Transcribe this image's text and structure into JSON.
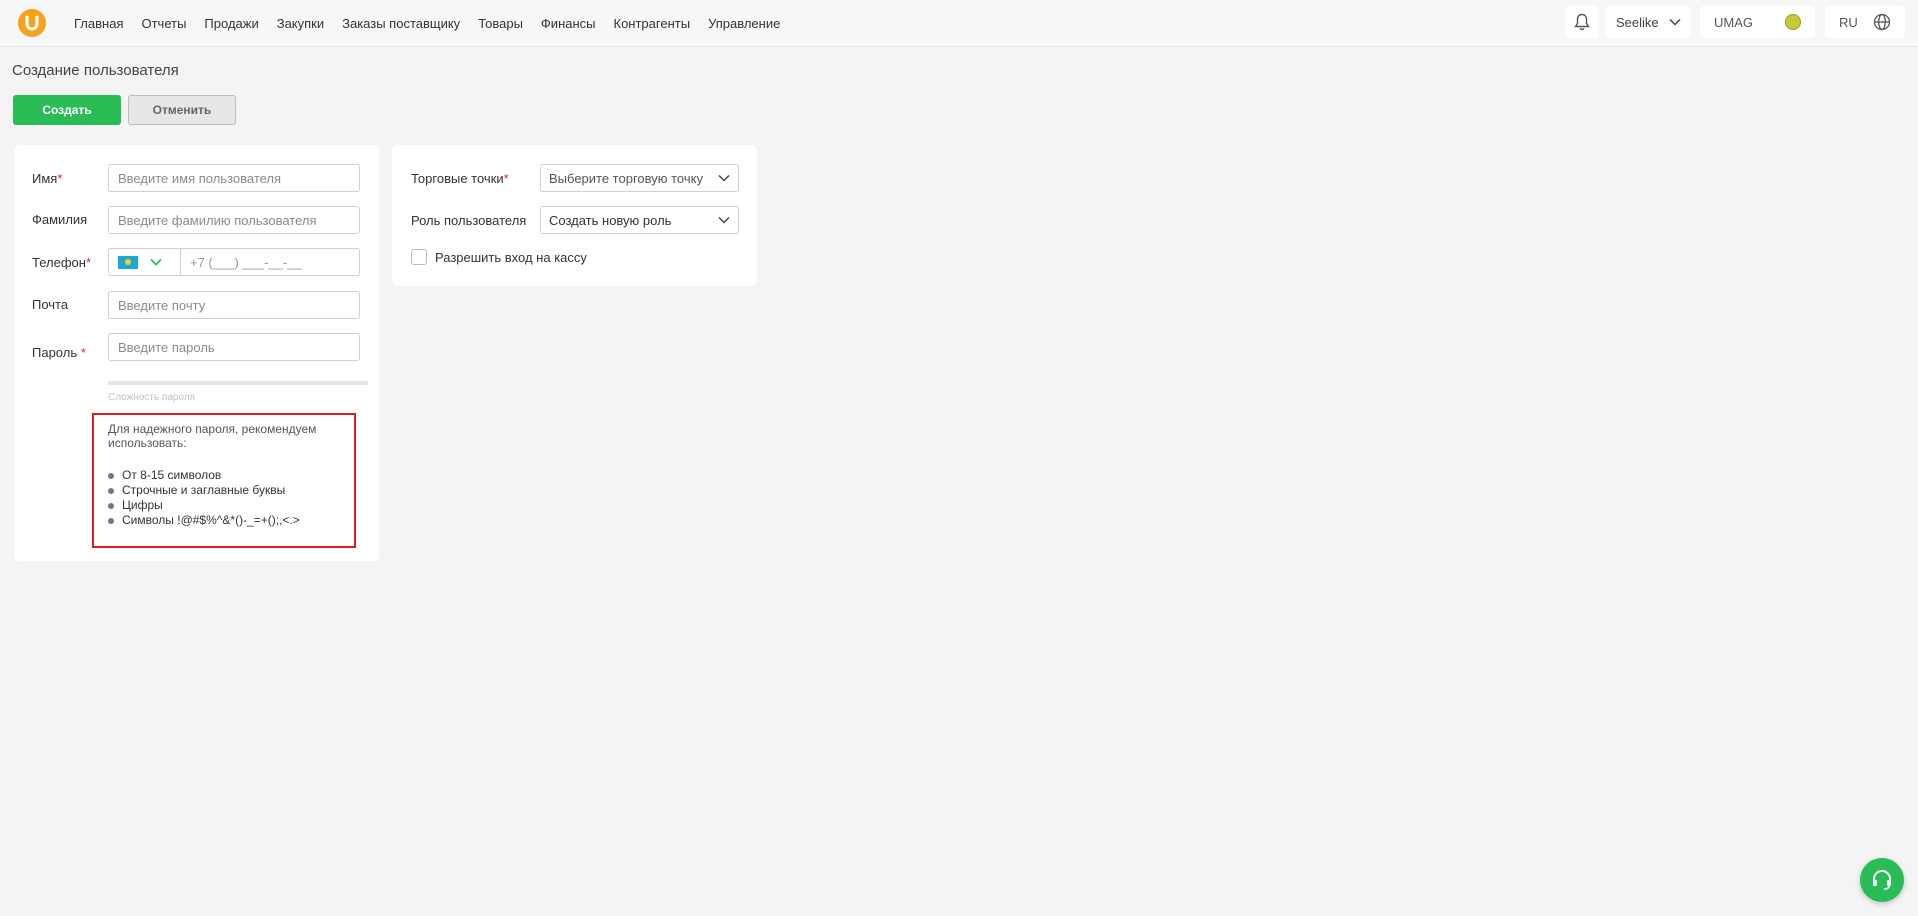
{
  "nav": {
    "items": [
      "Главная",
      "Отчеты",
      "Продажи",
      "Закупки",
      "Заказы поставщику",
      "Товары",
      "Финансы",
      "Контрагенты",
      "Управление"
    ]
  },
  "header": {
    "store": "Seelike",
    "user": "UMAG",
    "language": "RU"
  },
  "page": {
    "title": "Создание пользователя",
    "create_label": "Создать",
    "cancel_label": "Отменить"
  },
  "form": {
    "first_name": {
      "label": "Имя",
      "required": "*",
      "placeholder": "Введите имя пользователя"
    },
    "last_name": {
      "label": "Фамилия",
      "placeholder": "Введите фамилию пользователя"
    },
    "phone": {
      "label": "Телефон",
      "required": "*",
      "placeholder": "+7 (___) ___-__-__"
    },
    "email": {
      "label": "Почта",
      "placeholder": "Введите почту"
    },
    "password": {
      "label": "Пароль",
      "required": " *",
      "placeholder": "Введите пароль"
    },
    "strength_label": "Сложность пароля",
    "hint": {
      "intro": "Для надежного пароля, рекомендуем использовать:",
      "items": [
        "От 8-15 символов",
        "Строчные и заглавные буквы",
        "Цифры",
        "Символы !@#$%^&*()-_=+();,<.>"
      ]
    }
  },
  "right": {
    "stores": {
      "label": "Торговые точки",
      "required": "*",
      "placeholder": "Выберите торговую точку"
    },
    "role": {
      "label": "Роль пользователя",
      "value": "Создать новую роль"
    },
    "allow_cash": {
      "label": "Разрешить вход на кассу",
      "checked": false
    }
  },
  "colors": {
    "accent": "#2bbd55",
    "logo": "#f5a31a",
    "required": "#e0242f",
    "hint_border": "#e11c24"
  },
  "icons": [
    "logo-icon",
    "bell-icon",
    "chevron-down-icon",
    "globe-icon",
    "kazakhstan-flag-icon",
    "headset-icon"
  ]
}
